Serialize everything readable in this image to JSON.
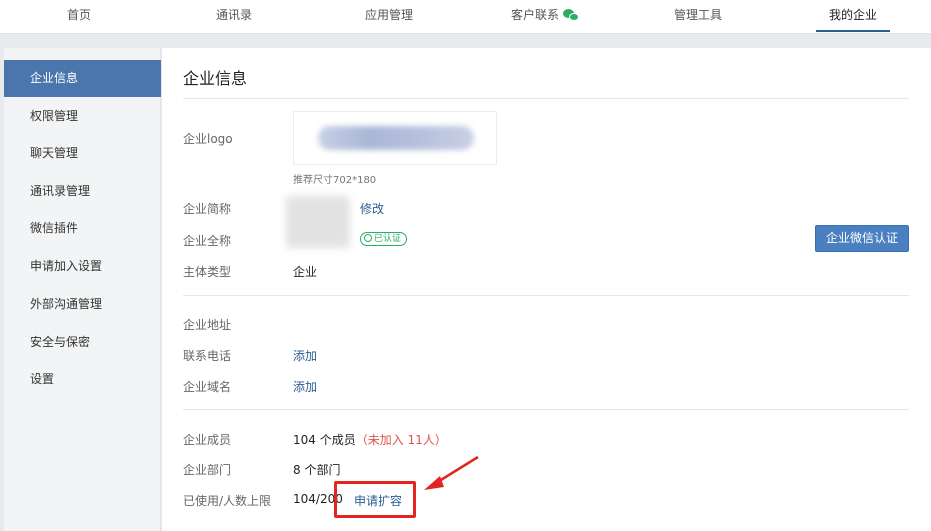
{
  "topnav": {
    "tabs": [
      {
        "label": "首页"
      },
      {
        "label": "通讯录"
      },
      {
        "label": "应用管理"
      },
      {
        "label": "客户联系"
      },
      {
        "label": "管理工具"
      },
      {
        "label": "我的企业"
      }
    ],
    "active_tab": "我的企业"
  },
  "sidebar": {
    "items": [
      {
        "label": "企业信息"
      },
      {
        "label": "权限管理"
      },
      {
        "label": "聊天管理"
      },
      {
        "label": "通讯录管理"
      },
      {
        "label": "微信插件"
      },
      {
        "label": "申请加入设置"
      },
      {
        "label": "外部沟通管理"
      },
      {
        "label": "安全与保密"
      },
      {
        "label": "设置"
      }
    ],
    "active_item": "企业信息"
  },
  "main": {
    "title": "企业信息",
    "logo": {
      "label": "企业logo",
      "hint": "推荐尺寸702*180"
    },
    "short_name": {
      "label": "企业简称",
      "action": "修改"
    },
    "full_name": {
      "label": "企业全称",
      "badge": "已认证"
    },
    "entity_type": {
      "label": "主体类型",
      "value": "企业"
    },
    "verify_button": "企业微信认证",
    "address": {
      "label": "企业地址"
    },
    "phone": {
      "label": "联系电话",
      "action": "添加"
    },
    "domain": {
      "label": "企业域名",
      "action": "添加"
    },
    "members": {
      "label": "企业成员",
      "value": "104 个成员",
      "unjoined": "（未加入 11人）"
    },
    "departments": {
      "label": "企业部门",
      "value": "8 个部门"
    },
    "capacity": {
      "label": "已使用/人数上限",
      "value": "104/200",
      "action": "申请扩容"
    }
  },
  "colors": {
    "accent": "#4a76ad",
    "link": "#2b5d94",
    "verified": "#2aae67",
    "warning": "#e0534a",
    "annotation": "#e2261f"
  }
}
